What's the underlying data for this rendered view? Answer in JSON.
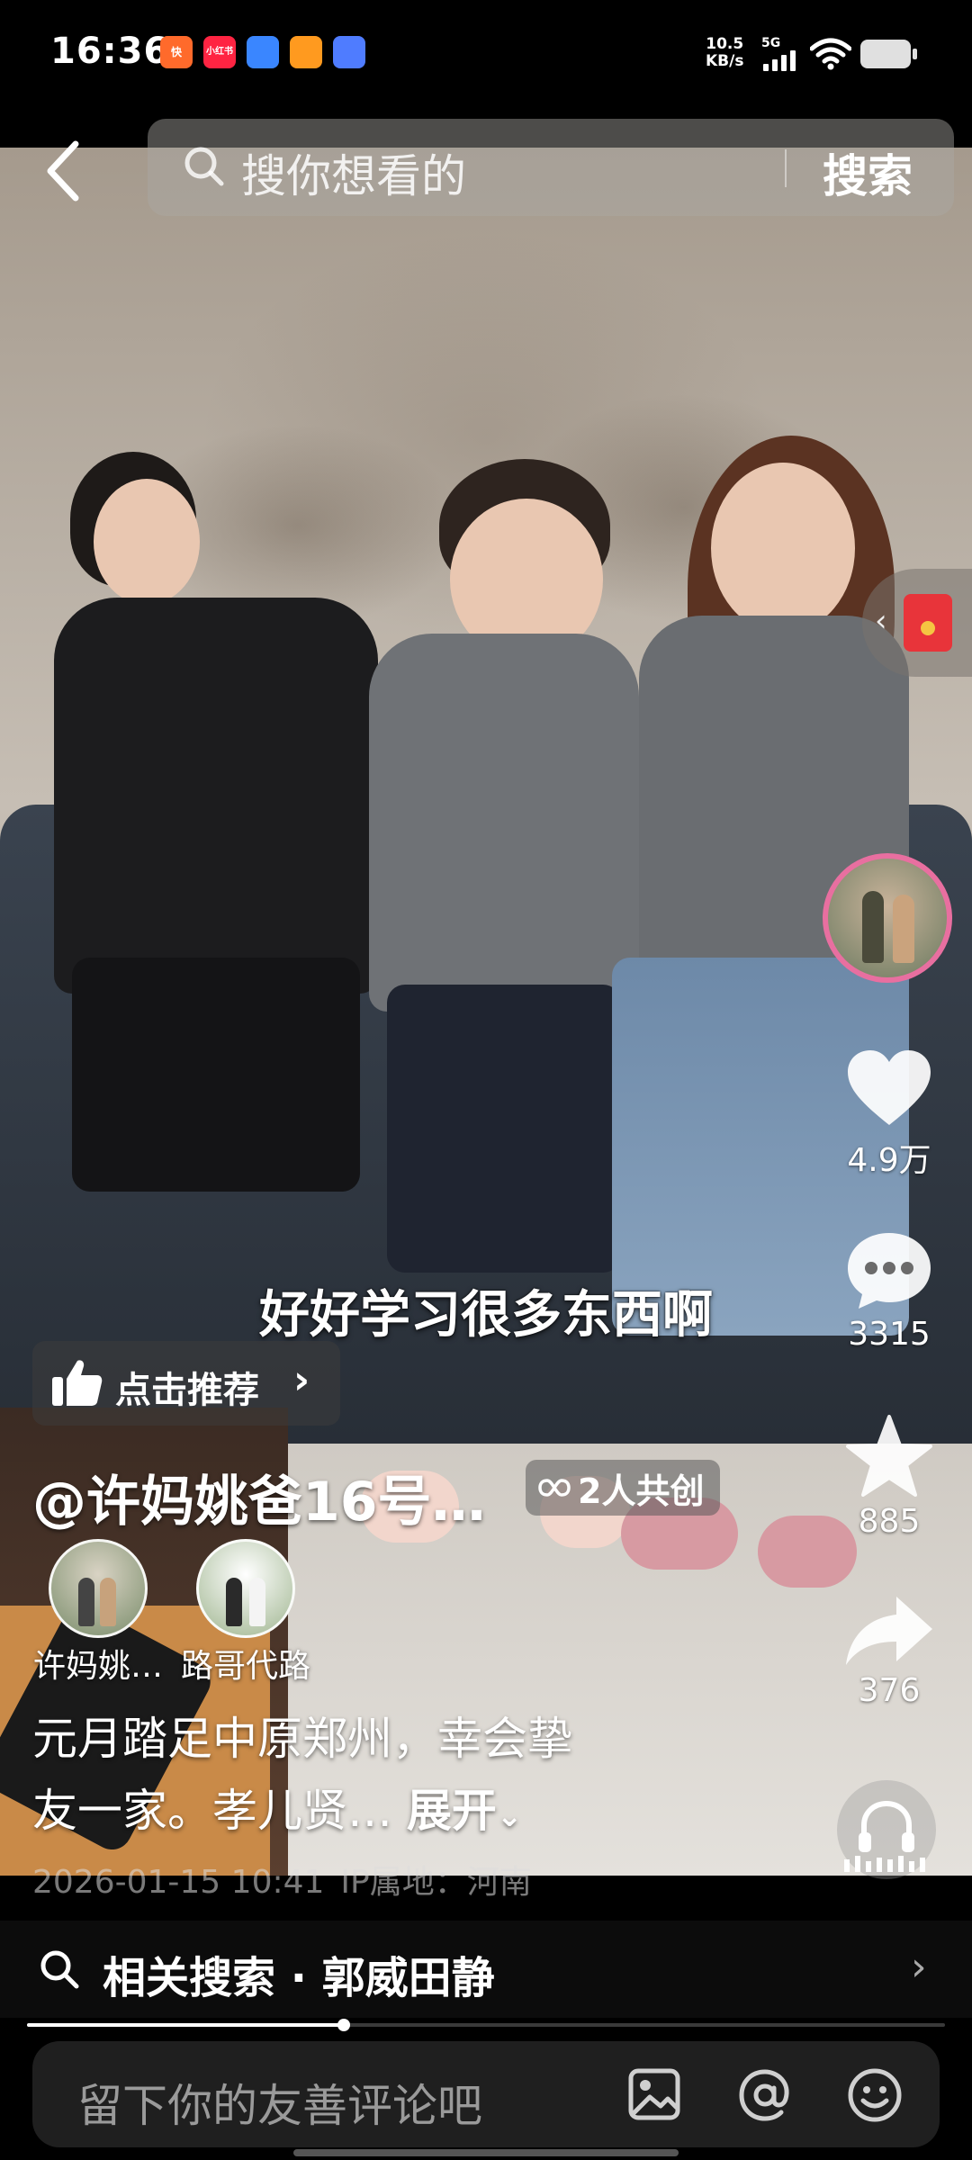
{
  "status_bar": {
    "time": "16:36",
    "app_icons": [
      {
        "label": "快",
        "color": "#ff6a2b"
      },
      {
        "label": "小红书",
        "color": "#ff2442"
      },
      {
        "label": "",
        "color": "#3a86ff"
      },
      {
        "label": "",
        "color": "#ff9a1f"
      },
      {
        "label": "",
        "color": "#4f7cff"
      }
    ],
    "net_speed_value": "10.5",
    "net_speed_unit": "KB/s",
    "network": "5G"
  },
  "search": {
    "placeholder": "搜你想看的",
    "button": "搜索"
  },
  "video": {
    "subtitle": "好好学习很多东西啊",
    "recommend_label": "点击推荐",
    "author_name": "@许妈姚爸16号…",
    "cocreate_label": "2人共创",
    "creators": [
      {
        "name": "许妈姚…"
      },
      {
        "name": "路哥代路"
      }
    ],
    "description_line1": "元月踏足中原郑州，幸会挚",
    "description_line2": "友一家。孝儿贤…",
    "expand_label": "展开",
    "date": "2026-01-15 10:41",
    "ip_location": "IP属地：河南"
  },
  "actions": {
    "likes": "4.9万",
    "comments": "3315",
    "favorites": "885",
    "shares": "376"
  },
  "related": {
    "label": "相关搜索 · 郭威田静"
  },
  "playback": {
    "progress": 0.345
  },
  "comment_bar": {
    "placeholder": "留下你的友善评论吧"
  },
  "colors": {
    "accent_pink": "#e86fa0",
    "red_packet": "#e8343a",
    "background": "#000000"
  }
}
